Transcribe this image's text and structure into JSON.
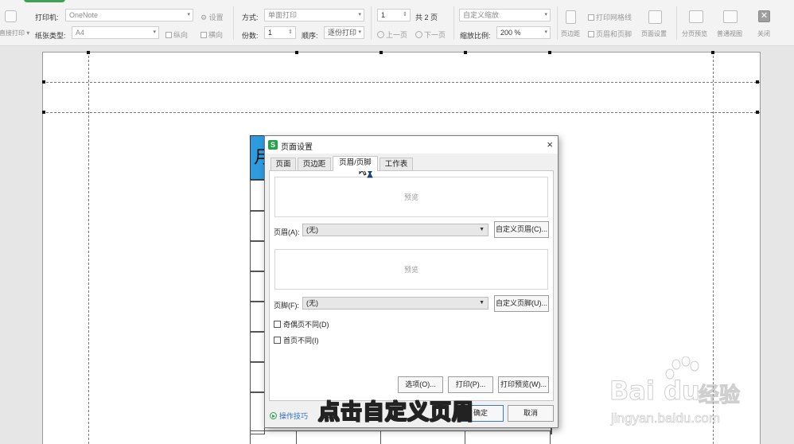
{
  "toolbar": {
    "direct_print_label": "直接打印",
    "printer_label": "打印机:",
    "printer_value": "OneNote",
    "printer_settings_label": "设置",
    "paper_type_label": "纸张类型:",
    "paper_type_value": "A4",
    "portrait_label": "纵向",
    "landscape_label": "横向",
    "mode_label": "方式:",
    "mode_value": "单面打印",
    "copies_label": "份数:",
    "copies_value": "1",
    "order_label": "顺序:",
    "order_value": "逐份打印",
    "page_number_value": "1",
    "total_pages_text": "共 2 页",
    "prev_page_label": "上一页",
    "next_page_label": "下一页",
    "zoom_mode_value": "自定义缩放",
    "zoom_ratio_label": "缩放比例:",
    "zoom_ratio_value": "200 %",
    "margins_label": "页边距",
    "print_gridlines_label": "打印网格线",
    "header_footer_label": "页眉和页脚",
    "page_setup_label": "页面设置",
    "page_break_preview_label": "分页预览",
    "normal_view_label": "普通视图",
    "close_label": "关闭"
  },
  "sheet": {
    "header_cell_glyph": "月"
  },
  "dialog": {
    "title": "页面设置",
    "close_glyph": "×",
    "tabs": [
      {
        "label": "页面"
      },
      {
        "label": "页边距"
      },
      {
        "label": "页眉/页脚"
      },
      {
        "label": "工作表"
      }
    ],
    "header_preview_text": "预览",
    "header_label": "页眉(A):",
    "header_value": "(无)",
    "custom_header_button": "自定义页眉(C)...",
    "footer_preview_text": "预览",
    "footer_label": "页脚(F):",
    "footer_value": "(无)",
    "custom_footer_button": "自定义页脚(U)...",
    "odd_even_label": "奇偶页不同(D)",
    "first_page_label": "首页不同(I)",
    "options_button": "选项(O)...",
    "print_button": "打印(P)...",
    "print_preview_button": "打印预览(W)...",
    "tips_label": "操作技巧",
    "ok_button": "确定",
    "cancel_button": "取消"
  },
  "subtitle": "点击自定义页眉",
  "watermark": {
    "brand": "Bai du",
    "brand_cn": "经验",
    "url": "jingyan.baidu.com"
  }
}
